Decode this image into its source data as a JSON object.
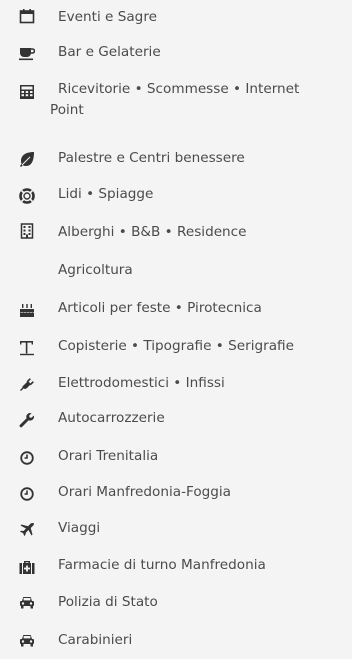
{
  "menu": {
    "items": [
      {
        "id": "eventi",
        "label": "Eventi e Sagre",
        "icon": "calendar-icon"
      },
      {
        "id": "bar",
        "label": "Bar e Gelaterie",
        "icon": "coffee-cup-icon"
      },
      {
        "id": "ricevitorie",
        "label_line1": "Ricevitorie  •  Scommesse  •  Internet",
        "label_line2": "Point",
        "icon": "calculator-icon"
      },
      {
        "id": "palestre",
        "label": "Palestre e Centri benessere",
        "icon": "leaf-icon"
      },
      {
        "id": "lidi",
        "label": "Lidi • Spiagge",
        "icon": "lifebuoy-icon"
      },
      {
        "id": "alberghi",
        "label": "Alberghi • B&B • Residence",
        "icon": "building-icon"
      },
      {
        "id": "agricoltura",
        "label": "Agricoltura",
        "icon": ""
      },
      {
        "id": "feste",
        "label": "Articoli per feste • Pirotecnica",
        "icon": "birthday-cake-icon"
      },
      {
        "id": "copisterie",
        "label": "Copisterie • Tipografie • Serigrafie",
        "icon": "text-height-icon"
      },
      {
        "id": "elettrodomestici",
        "label": "Elettrodomestici  •  Infissi",
        "icon": "plug-icon"
      },
      {
        "id": "autocarrozzerie",
        "label": "Autocarrozzerie",
        "icon": "wrench-icon"
      },
      {
        "id": "trenitalia",
        "label": "Orari Trenitalia",
        "icon": "clock-icon"
      },
      {
        "id": "manfredonia_foggia",
        "label": "Orari Manfredonia-Foggia",
        "icon": "clock-icon"
      },
      {
        "id": "viaggi",
        "label": "Viaggi",
        "icon": "plane-icon"
      },
      {
        "id": "farmacie",
        "label": "Farmacie di turno Manfredonia",
        "icon": "medkit-icon"
      },
      {
        "id": "polizia",
        "label": "Polizia di Stato",
        "icon": "car-icon"
      },
      {
        "id": "carabinieri",
        "label": "Carabinieri",
        "icon": "car-icon"
      }
    ]
  },
  "colors": {
    "background": "#f4f4f4",
    "text": "#4b4b4b",
    "icon": "#333333"
  }
}
